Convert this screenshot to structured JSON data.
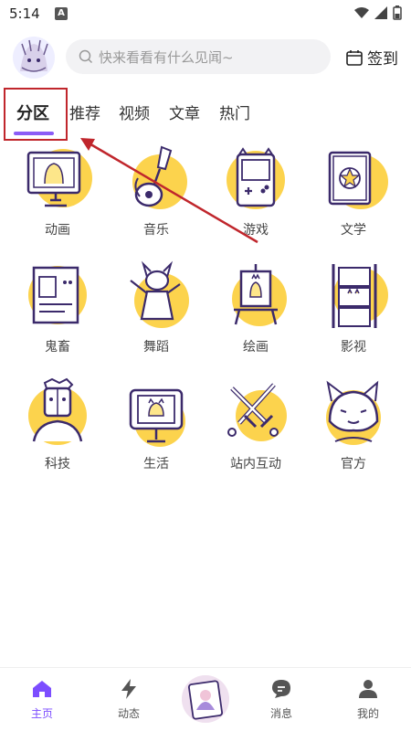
{
  "status": {
    "time": "5:14",
    "notif": "A"
  },
  "header": {
    "search_placeholder": "快来看看有什么见闻~",
    "signin_label": "签到"
  },
  "tabs": [
    {
      "label": "分区"
    },
    {
      "label": "推荐"
    },
    {
      "label": "视频"
    },
    {
      "label": "文章"
    },
    {
      "label": "热门"
    }
  ],
  "categories": [
    {
      "label": "动画",
      "icon": "monitor-icon"
    },
    {
      "label": "音乐",
      "icon": "guitar-icon"
    },
    {
      "label": "游戏",
      "icon": "gameboy-icon"
    },
    {
      "label": "文学",
      "icon": "book-icon"
    },
    {
      "label": "鬼畜",
      "icon": "poster-icon"
    },
    {
      "label": "舞蹈",
      "icon": "dancer-icon"
    },
    {
      "label": "绘画",
      "icon": "easel-icon"
    },
    {
      "label": "影视",
      "icon": "film-icon"
    },
    {
      "label": "科技",
      "icon": "robot-icon"
    },
    {
      "label": "生活",
      "icon": "camera-icon"
    },
    {
      "label": "站内互动",
      "icon": "swords-icon"
    },
    {
      "label": "官方",
      "icon": "mascot-icon"
    }
  ],
  "bottom_nav": [
    {
      "label": "主页"
    },
    {
      "label": "动态"
    },
    {
      "label": "消息"
    },
    {
      "label": "我的"
    }
  ],
  "colors": {
    "accent": "#8b5cf6",
    "icon_bg": "#fcd34d",
    "icon_stroke": "#3b2a6b",
    "highlight": "#c0262c"
  }
}
